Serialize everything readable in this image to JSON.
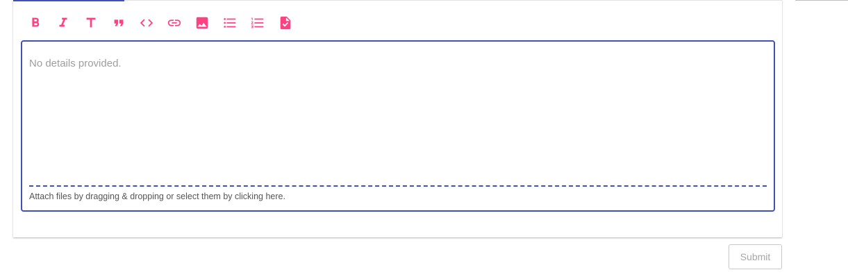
{
  "editor": {
    "toolbar": {
      "items": [
        {
          "name": "bold",
          "icon": "bold-icon"
        },
        {
          "name": "italic",
          "icon": "italic-icon"
        },
        {
          "name": "header",
          "icon": "header-icon"
        },
        {
          "name": "quote",
          "icon": "quote-icon"
        },
        {
          "name": "code",
          "icon": "code-icon"
        },
        {
          "name": "link",
          "icon": "link-icon"
        },
        {
          "name": "image",
          "icon": "image-icon"
        },
        {
          "name": "unordered-list",
          "icon": "bulleted-list-icon"
        },
        {
          "name": "ordered-list",
          "icon": "numbered-list-icon"
        },
        {
          "name": "task-list",
          "icon": "checklist-document-icon"
        }
      ]
    },
    "content_text": "No details provided.",
    "dropzone_text": "Attach files by dragging & dropping or select them by clicking here."
  },
  "actions": {
    "submit_label": "Submit"
  },
  "colors": {
    "accent": "#ff4081",
    "primary": "#3f51b5",
    "placeholder_text": "#9e9e9e",
    "disabled_text": "#a6a6a6"
  }
}
